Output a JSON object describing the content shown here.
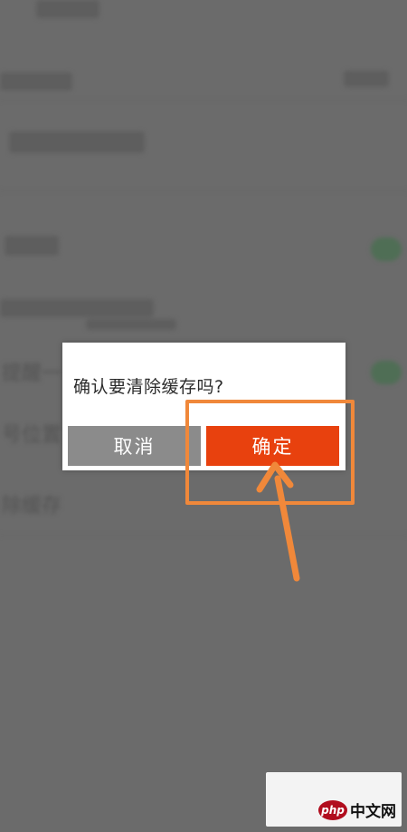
{
  "dialog": {
    "message": "确认要清除缓存吗?",
    "cancel_label": "取消",
    "confirm_label": "确定"
  },
  "background_partial_text": {
    "item_a": "提醒一",
    "item_b": "号位置",
    "item_c": "除缓存"
  },
  "watermark": {
    "brand_badge": "php",
    "brand_text": "中文网"
  },
  "colors": {
    "confirm_button": "#e8410e",
    "cancel_button": "#8b8b8b",
    "annotation": "#f0883a",
    "overlay": "#6b6b6b"
  },
  "icons": {
    "annotation_arrow": "arrow-up-left-icon"
  }
}
